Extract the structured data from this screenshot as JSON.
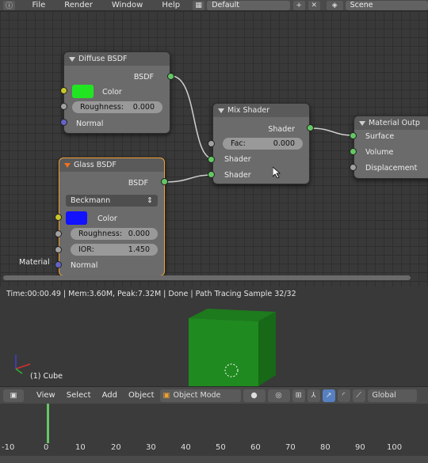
{
  "topbar": {
    "menus": [
      "File",
      "Render",
      "Window",
      "Help"
    ],
    "screen_layout": "Default",
    "scene": "Scene"
  },
  "nodes": {
    "diffuse": {
      "title": "Diffuse BSDF",
      "output": "BSDF",
      "color_label": "Color",
      "color_value": "#22e522",
      "roughness_label": "Roughness:",
      "roughness_value": "0.000",
      "normal_label": "Normal"
    },
    "glass": {
      "title": "Glass BSDF",
      "output": "BSDF",
      "distribution": "Beckmann",
      "color_label": "Color",
      "color_value": "#1212ff",
      "roughness_label": "Roughness:",
      "roughness_value": "0.000",
      "ior_label": "IOR:",
      "ior_value": "1.450",
      "normal_label": "Normal"
    },
    "mix": {
      "title": "Mix Shader",
      "output": "Shader",
      "fac_label": "Fac:",
      "fac_value": "0.000",
      "shader1": "Shader",
      "shader2": "Shader"
    },
    "output": {
      "title": "Material Outp",
      "surface": "Surface",
      "volume": "Volume",
      "displacement": "Displacement"
    },
    "material_label": "Material"
  },
  "viewport": {
    "status": "Time:00:00.49 | Mem:3.60M, Peak:7.32M | Done | Path Tracing Sample 32/32",
    "object": "(1) Cube",
    "cube_color": "#1f8a1f"
  },
  "toolbar": {
    "menus": [
      "View",
      "Select",
      "Add",
      "Object"
    ],
    "mode": "Object Mode",
    "orientation": "Global"
  },
  "timeline": {
    "ticks": [
      "-10",
      "0",
      "10",
      "20",
      "30",
      "40",
      "50",
      "60",
      "70",
      "80",
      "90",
      "100"
    ],
    "current_frame": 1
  }
}
